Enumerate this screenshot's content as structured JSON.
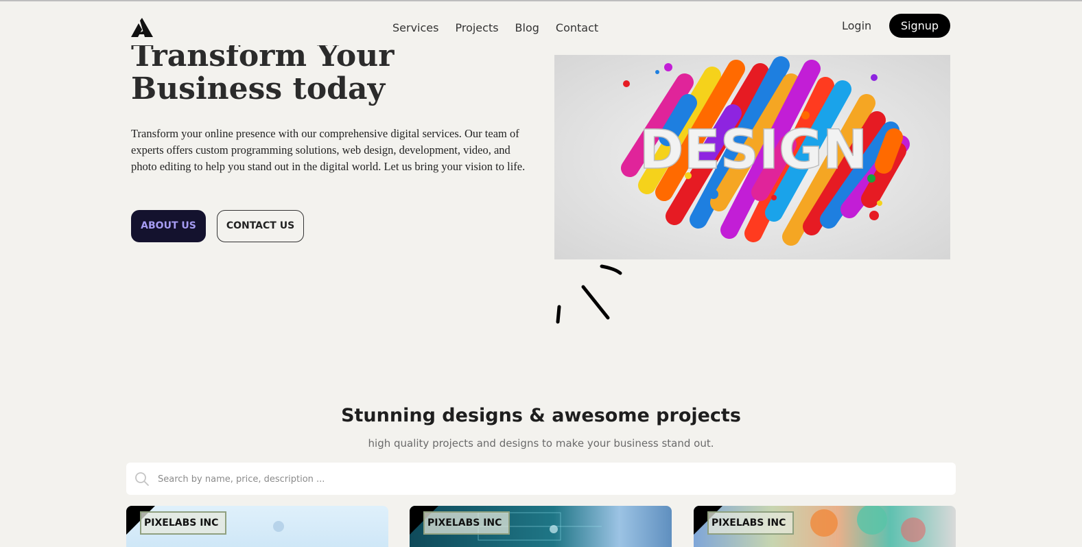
{
  "nav": {
    "logo_icon": "triangle-logo-icon",
    "links": [
      "Services",
      "Projects",
      "Blog",
      "Contact"
    ],
    "login": "Login",
    "signup": "Signup"
  },
  "hero": {
    "title": "Transform Your Business today",
    "text": "Transform your online presence with our comprehensive digital services. Our team of experts offers custom programming solutions, web design, development, video, and photo editing to help you stand out in the digital world. Let us bring your vision to life.",
    "about_btn": "ABOUT US",
    "contact_btn": "CONTACT US",
    "image_text": "DESIGN"
  },
  "projects": {
    "title": "Stunning designs & awesome projects",
    "subtitle": "high quality projects and designs to make your business stand out.",
    "search_placeholder": "Search by name, price, description ...",
    "cards": [
      {
        "tag": "PIXELABS INC"
      },
      {
        "tag": "PIXELABS INC"
      },
      {
        "tag": "PIXELABS INC"
      }
    ]
  },
  "colors": {
    "background": "#f3f2ee",
    "primary_dark": "#14122e",
    "about_text": "#a69cf2"
  }
}
